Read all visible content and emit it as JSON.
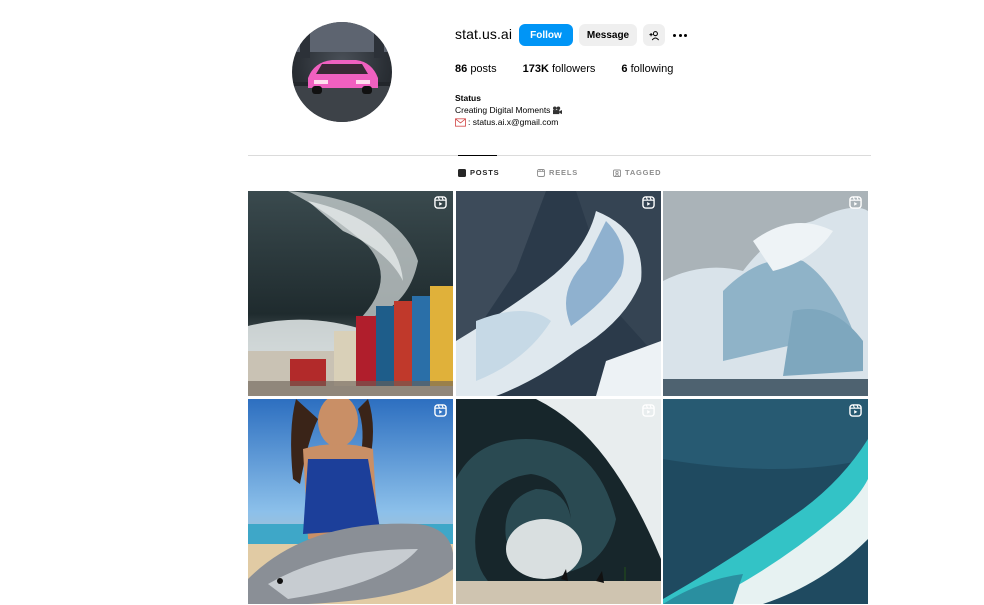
{
  "profile": {
    "username": "stat.us.ai",
    "follow_label": "Follow",
    "message_label": "Message",
    "stats": {
      "posts_count": "86",
      "posts_label": "posts",
      "followers_count": "173K",
      "followers_label": "followers",
      "following_count": "6",
      "following_label": "following"
    },
    "bio": {
      "name": "Status",
      "line1": "Creating Digital Moments",
      "line2": ": status.ai.x@gmail.com"
    }
  },
  "tabs": [
    {
      "label": "POSTS",
      "active": true
    },
    {
      "label": "REELS",
      "active": false
    },
    {
      "label": "TAGGED",
      "active": false
    }
  ],
  "colors": {
    "follow_button": "#0095f6",
    "secondary_button": "#efefef",
    "divider": "#dbdbdb",
    "inactive_tab": "#8e8e8e"
  },
  "posts": [
    {
      "subject": "giant wave over colorful houses",
      "is_reel": true
    },
    {
      "subject": "aerial waterfall on dark rocks",
      "is_reel": true
    },
    {
      "subject": "ice glacier wave",
      "is_reel": true
    },
    {
      "subject": "girl with dolphin on beach",
      "is_reel": true
    },
    {
      "subject": "barrel wave over beach",
      "is_reel": true
    },
    {
      "subject": "aerial turquoise wave",
      "is_reel": true
    }
  ]
}
